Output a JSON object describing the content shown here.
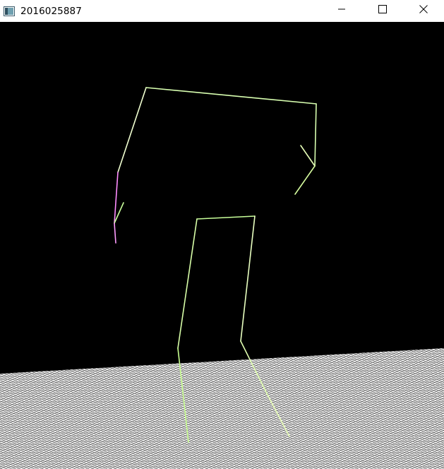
{
  "window": {
    "title": "2016025887",
    "icons": {
      "app": "window-app-icon",
      "minimize": "minimize-icon",
      "maximize": "maximize-icon",
      "close": "close-icon"
    }
  },
  "scene": {
    "background_color": "#000000",
    "floor_color": "#ffffff",
    "figure_color": "#e8ffa8",
    "figure_accent_color": "#ff8cff"
  }
}
